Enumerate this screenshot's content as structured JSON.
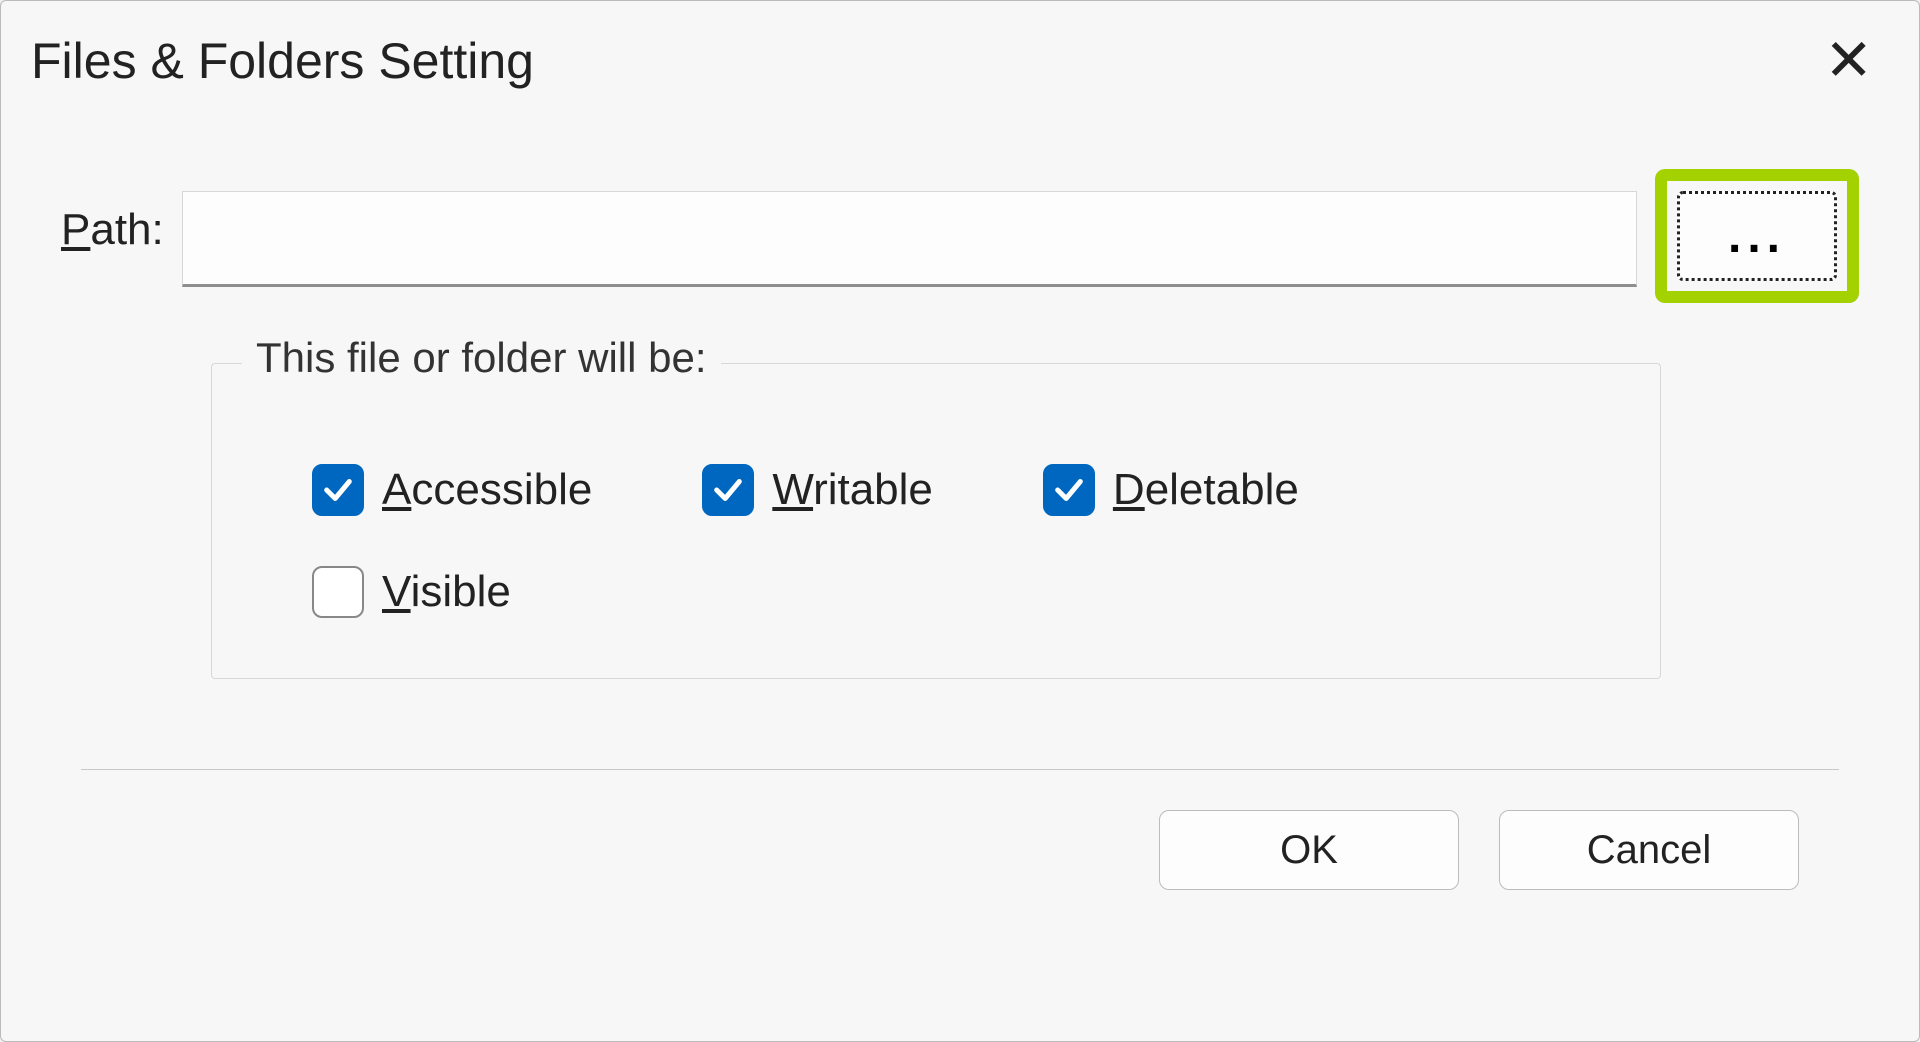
{
  "dialog": {
    "title": "Files & Folders Setting",
    "path_label_prefix": "P",
    "path_label_rest": "ath:",
    "path_value": "",
    "browse_label": "...",
    "group_legend": "This file or folder will be:",
    "checks": {
      "accessible": {
        "prefix": "A",
        "rest": "ccessible",
        "checked": true
      },
      "writable": {
        "prefix": "W",
        "rest": "ritable",
        "checked": true
      },
      "deletable": {
        "prefix": "D",
        "rest": "eletable",
        "checked": true
      },
      "visible": {
        "prefix": "V",
        "rest": "isible",
        "checked": false
      }
    },
    "ok_label": "OK",
    "cancel_label": "Cancel"
  }
}
